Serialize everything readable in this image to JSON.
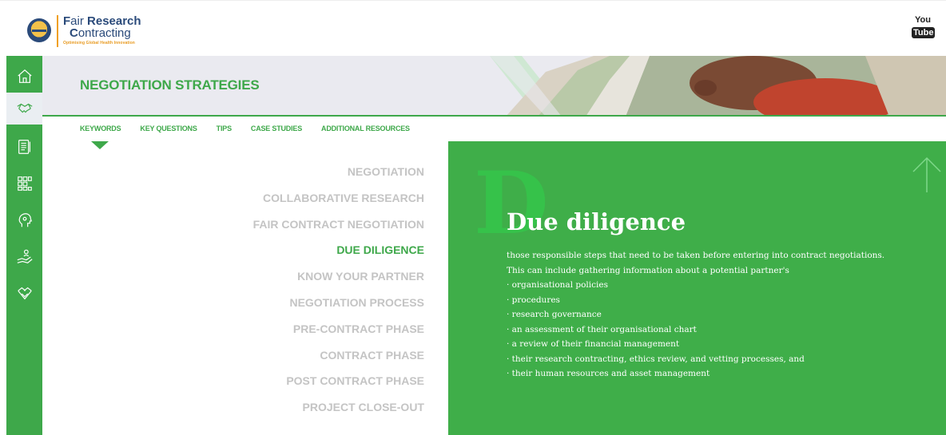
{
  "brand": {
    "name_line1_initial": "F",
    "name_line1_rest": "air ",
    "name_line1_bold": "Research",
    "name_line2_initial": "C",
    "name_line2_rest": "ontracting",
    "tagline": "Optimising Global Health Innovation"
  },
  "youtube": {
    "top": "You",
    "bottom": "Tube"
  },
  "sidebar": {
    "items": [
      {
        "icon": "home-icon",
        "active": false
      },
      {
        "icon": "handshake-icon",
        "active": true
      },
      {
        "icon": "document-icon",
        "active": false
      },
      {
        "icon": "network-icon",
        "active": false
      },
      {
        "icon": "head-idea-icon",
        "active": false
      },
      {
        "icon": "helping-hand-icon",
        "active": false
      },
      {
        "icon": "agreement-icon",
        "active": false
      }
    ]
  },
  "page": {
    "title": "NEGOTIATION STRATEGIES"
  },
  "tabs": [
    {
      "label": "KEYWORDS"
    },
    {
      "label": "KEY QUESTIONS"
    },
    {
      "label": "TIPS"
    },
    {
      "label": "CASE STUDIES"
    },
    {
      "label": "ADDITIONAL RESOURCES"
    }
  ],
  "keywords": [
    {
      "label": "NEGOTIATION",
      "active": false
    },
    {
      "label": "COLLABORATIVE RESEARCH",
      "active": false
    },
    {
      "label": "FAIR CONTRACT NEGOTIATION",
      "active": false
    },
    {
      "label": "DUE DILIGENCE",
      "active": true
    },
    {
      "label": "KNOW YOUR PARTNER",
      "active": false
    },
    {
      "label": "NEGOTIATION PROCESS",
      "active": false
    },
    {
      "label": "PRE-CONTRACT PHASE",
      "active": false
    },
    {
      "label": "CONTRACT PHASE",
      "active": false
    },
    {
      "label": "POST CONTRACT PHASE",
      "active": false
    },
    {
      "label": "PROJECT CLOSE-OUT",
      "active": false
    }
  ],
  "panel": {
    "big_letter": "D",
    "title": "Due diligence",
    "lines": [
      "those responsible steps that need to be taken before entering into contract negotiations.",
      "This can include gathering information about a potential partner's",
      "· organisational policies",
      "· procedures",
      "· research governance",
      "· an assessment of their organisational chart",
      "· a review of their financial management",
      "· their research contracting, ethics review, and vetting processes, and",
      "· their human resources and asset management"
    ]
  },
  "colors": {
    "accent": "#3ea84a",
    "panel": "#3fae49",
    "inactive": "#c4c4c4"
  }
}
